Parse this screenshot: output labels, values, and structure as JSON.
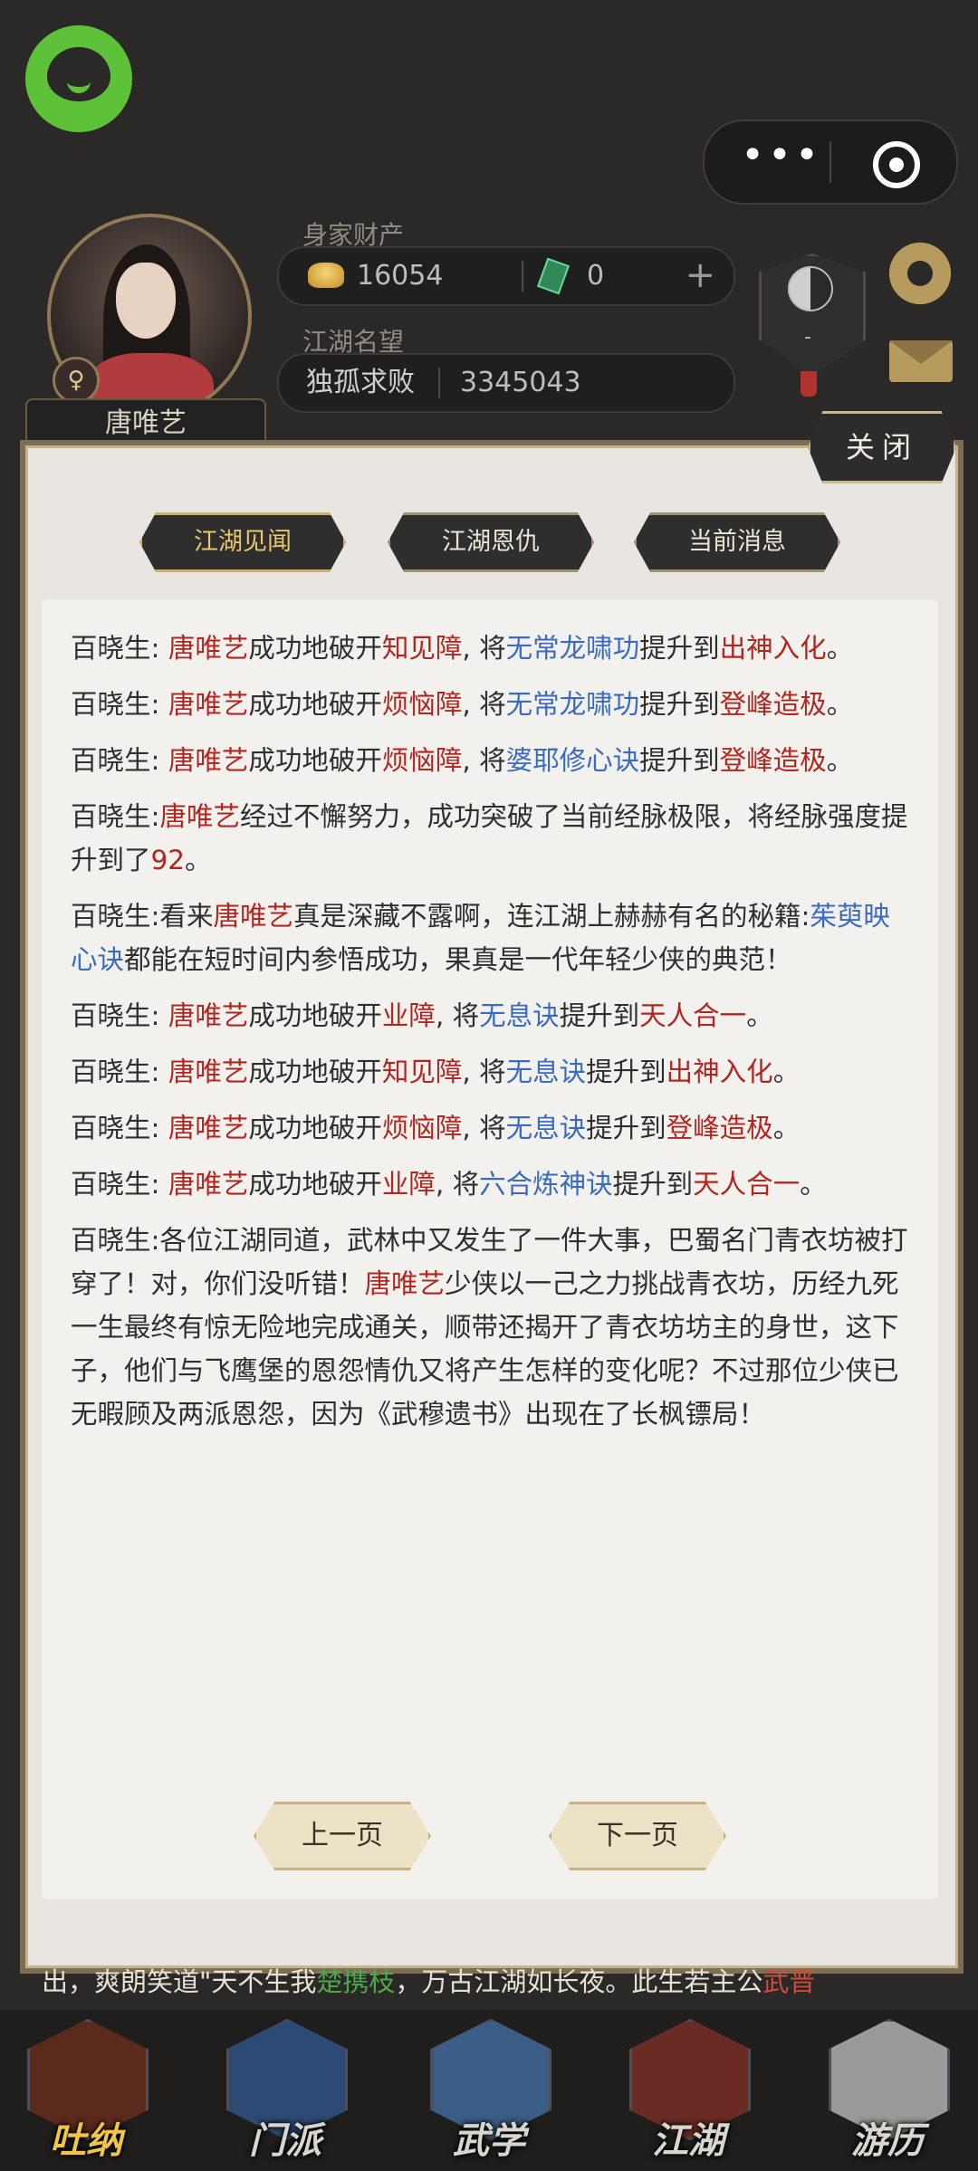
{
  "profile": {
    "name": "唐唯艺",
    "gender_symbol": "♀",
    "wealth_label": "身家财产",
    "gold": "16054",
    "jade": "0",
    "plus": "+",
    "reputation_label": "江湖名望",
    "reputation_title": "独孤求败",
    "reputation_value": "3345043",
    "taiji_level": "-"
  },
  "capsule": {
    "more": "•••"
  },
  "panel": {
    "close_label": "关闭",
    "tabs": [
      "江湖见闻",
      "江湖恩仇",
      "当前消息"
    ],
    "active_tab": 0,
    "prev_label": "上一页",
    "next_label": "下一页",
    "messages": [
      [
        {
          "t": "百晓生: "
        },
        {
          "t": "唐唯艺",
          "c": "red"
        },
        {
          "t": "成功地破开"
        },
        {
          "t": "知见障",
          "c": "red"
        },
        {
          "t": ", 将"
        },
        {
          "t": "无常龙啸功",
          "c": "blue"
        },
        {
          "t": "提升到"
        },
        {
          "t": "出神入化",
          "c": "red"
        },
        {
          "t": "。"
        }
      ],
      [
        {
          "t": "百晓生: "
        },
        {
          "t": "唐唯艺",
          "c": "red"
        },
        {
          "t": "成功地破开"
        },
        {
          "t": "烦恼障",
          "c": "red"
        },
        {
          "t": ", 将"
        },
        {
          "t": "无常龙啸功",
          "c": "blue"
        },
        {
          "t": "提升到"
        },
        {
          "t": "登峰造极",
          "c": "red"
        },
        {
          "t": "。"
        }
      ],
      [
        {
          "t": "百晓生: "
        },
        {
          "t": "唐唯艺",
          "c": "red"
        },
        {
          "t": "成功地破开"
        },
        {
          "t": "烦恼障",
          "c": "red"
        },
        {
          "t": ", 将"
        },
        {
          "t": "婆耶修心诀",
          "c": "blue"
        },
        {
          "t": "提升到"
        },
        {
          "t": "登峰造极",
          "c": "red"
        },
        {
          "t": "。"
        }
      ],
      [
        {
          "t": "百晓生:"
        },
        {
          "t": "唐唯艺",
          "c": "red"
        },
        {
          "t": "经过不懈努力，成功突破了当前经脉极限，将经脉强度提升到了"
        },
        {
          "t": "92",
          "c": "red"
        },
        {
          "t": "。"
        }
      ],
      [
        {
          "t": "百晓生:看来"
        },
        {
          "t": "唐唯艺",
          "c": "red"
        },
        {
          "t": "真是深藏不露啊，连江湖上赫赫有名的秘籍:"
        },
        {
          "t": "茱萸映心诀",
          "c": "blue"
        },
        {
          "t": "都能在短时间内参悟成功，果真是一代年轻少侠的典范！"
        }
      ],
      [
        {
          "t": "百晓生: "
        },
        {
          "t": "唐唯艺",
          "c": "red"
        },
        {
          "t": "成功地破开"
        },
        {
          "t": "业障",
          "c": "red"
        },
        {
          "t": ", 将"
        },
        {
          "t": "无息诀",
          "c": "blue"
        },
        {
          "t": "提升到"
        },
        {
          "t": "天人合一",
          "c": "red"
        },
        {
          "t": "。"
        }
      ],
      [
        {
          "t": "百晓生: "
        },
        {
          "t": "唐唯艺",
          "c": "red"
        },
        {
          "t": "成功地破开"
        },
        {
          "t": "知见障",
          "c": "red"
        },
        {
          "t": ", 将"
        },
        {
          "t": "无息诀",
          "c": "blue"
        },
        {
          "t": "提升到"
        },
        {
          "t": "出神入化",
          "c": "red"
        },
        {
          "t": "。"
        }
      ],
      [
        {
          "t": "百晓生: "
        },
        {
          "t": "唐唯艺",
          "c": "red"
        },
        {
          "t": "成功地破开"
        },
        {
          "t": "烦恼障",
          "c": "red"
        },
        {
          "t": ", 将"
        },
        {
          "t": "无息诀",
          "c": "blue"
        },
        {
          "t": "提升到"
        },
        {
          "t": "登峰造极",
          "c": "red"
        },
        {
          "t": "。"
        }
      ],
      [
        {
          "t": "百晓生: "
        },
        {
          "t": "唐唯艺",
          "c": "red"
        },
        {
          "t": "成功地破开"
        },
        {
          "t": "业障",
          "c": "red"
        },
        {
          "t": ", 将"
        },
        {
          "t": "六合炼神诀",
          "c": "blue"
        },
        {
          "t": "提升到"
        },
        {
          "t": "天人合一",
          "c": "red"
        },
        {
          "t": "。"
        }
      ],
      [
        {
          "t": "百晓生:各位江湖同道，武林中又发生了一件大事，巴蜀名门青衣坊被打穿了！对，你们没听错！"
        },
        {
          "t": "唐唯艺",
          "c": "red"
        },
        {
          "t": "少侠以一己之力挑战青衣坊，历经九死一生最终有惊无险地完成通关，顺带还揭开了青衣坊坊主的身世，这下子，他们与飞鹰堡的恩怨情仇又将产生怎样的变化呢？不过那位少侠已无暇顾及两派恩怨，因为《武穆遗书》出现在了长枫镖局！"
        }
      ]
    ]
  },
  "marquee": [
    {
      "t": "出，爽朗笑道\"天不生我"
    },
    {
      "t": "楚携枝",
      "c": "green"
    },
    {
      "t": "，万古江湖如长夜。此生若主公"
    },
    {
      "t": "武晋",
      "c": "red"
    }
  ],
  "nav": {
    "items": [
      "吐纳",
      "门派",
      "武学",
      "江湖",
      "游历"
    ],
    "active": 0
  }
}
